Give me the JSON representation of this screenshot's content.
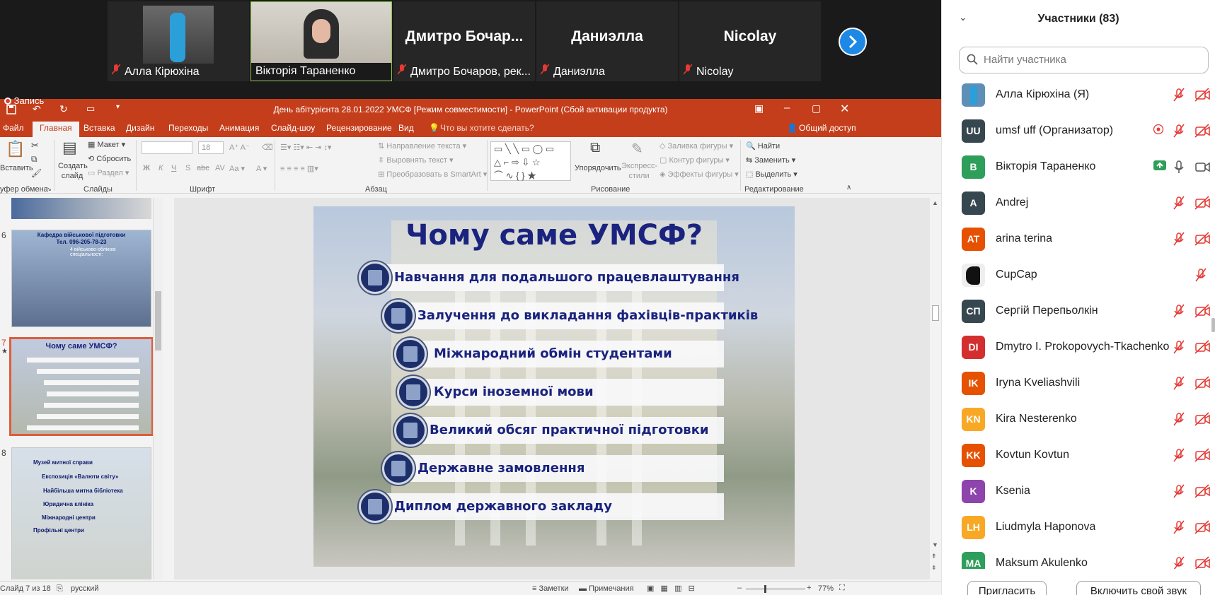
{
  "colors": {
    "ppt_accent": "#c43e1c",
    "slide_text": "#1a237e",
    "zoom_blue": "#1e88e5",
    "mute_red": "#e53935"
  },
  "videos": [
    {
      "name": "",
      "caption": "Алла Кірюхіна",
      "muted": true,
      "type": "photo"
    },
    {
      "name": "",
      "caption": "Вікторія Тараненко",
      "muted": false,
      "type": "camera"
    },
    {
      "name": "Дмитро  Бочар...",
      "caption": "Дмитро Бочаров, рек...",
      "muted": true
    },
    {
      "name": "Даниэлла",
      "caption": "Даниэлла",
      "muted": true
    },
    {
      "name": "Nicolay",
      "caption": "Nicolay",
      "muted": true
    }
  ],
  "recording_label": "Запись",
  "ppt": {
    "window_title": "День абітурієнта 28.01.2022 УМСФ [Режим совместимости] - PowerPoint (Сбой активации продукта)",
    "tabs": [
      "Файл",
      "Главная",
      "Вставка",
      "Дизайн",
      "Переходы",
      "Анимация",
      "Слайд-шоу",
      "Рецензирование",
      "Вид"
    ],
    "tell_me": "Что вы хотите сделать?",
    "share": "Общий доступ",
    "ribbon": {
      "paste": "Вставить",
      "create_slide": "Создать слайд",
      "layout": "Макет",
      "reset": "Сбросить",
      "section": "Раздел",
      "font_size": "18",
      "text_direction": "Направление текста",
      "align_text": "Выровнять текст",
      "convert_smartart": "Преобразовать в SmartArt",
      "arrange": "Упорядочить",
      "express_styles": "Экспресс-стили",
      "shape_fill": "Заливка фигуры",
      "shape_outline": "Контур фигуры",
      "shape_effects": "Эффекты фигуры",
      "find": "Найти",
      "replace": "Заменить",
      "select": "Выделить",
      "groups": {
        "clipboard": "уфер обмена",
        "slides": "Слайды",
        "font": "Шрифт",
        "paragraph": "Абзац",
        "drawing": "Рисование",
        "editing": "Редактирование"
      }
    },
    "thumbs": [
      {
        "num": "6",
        "title": "Кафедра військової підготовки",
        "phone": "Тел. 096-205-78-23",
        "sub": "4 військово-облікові спеціальності:"
      },
      {
        "num": "7",
        "title": "Чому саме УМСФ?",
        "selected": true
      },
      {
        "num": "8",
        "lines": [
          "Музей митної справи",
          "Експозиція «Валюти світу»",
          "Найбільша митна бібліотека",
          "Юридична клініка",
          "Міжнародні центри",
          "Профільні центри"
        ]
      }
    ],
    "slide": {
      "title": "Чому саме УМСФ?",
      "items": [
        "Навчання для подальшого працевлаштування",
        "Залучення до викладання фахівців-практиків",
        "Міжнародний обмін студентами",
        "Курси іноземної мови",
        "Великий обсяг практичної підготовки",
        "Державне замовлення",
        "Диплом державного закладу"
      ]
    },
    "status": {
      "slide_info": "Слайд 7 из 18",
      "language": "русский",
      "notes": "Заметки",
      "comments": "Примечания",
      "zoom": "77%"
    }
  },
  "panel": {
    "title": "Участники (83)",
    "search_placeholder": "Найти участника",
    "participants": [
      {
        "name": "Алла Кірюхіна (Я)",
        "initials": "",
        "color": "#5d8fb8",
        "icons": [
          "mic-off",
          "video-off"
        ]
      },
      {
        "name": "umsf uff (Организатор)",
        "initials": "UU",
        "color": "#37474f",
        "icons": [
          "record",
          "mic-off",
          "video-off"
        ]
      },
      {
        "name": "Вікторія Тараненко",
        "initials": "B",
        "color": "#2e9e5b",
        "icons": [
          "share",
          "mic",
          "video"
        ]
      },
      {
        "name": "Andrej",
        "initials": "A",
        "color": "#37474f",
        "icons": [
          "mic-off",
          "video-off"
        ]
      },
      {
        "name": "arina terina",
        "initials": "AT",
        "color": "#e65100",
        "icons": [
          "mic-off",
          "video-off"
        ]
      },
      {
        "name": "CupCap",
        "initials": "",
        "color": "#eeeeee",
        "icons": [
          "mic-off"
        ]
      },
      {
        "name": "Сергій Перепьолкін",
        "initials": "СП",
        "color": "#37474f",
        "icons": [
          "mic-off",
          "video-off"
        ]
      },
      {
        "name": "Dmytro I. Prokopovych-Tkachenko",
        "initials": "DI",
        "color": "#d32f2f",
        "icons": [
          "mic-off",
          "video-off"
        ]
      },
      {
        "name": "Iryna Kveliashvili",
        "initials": "IK",
        "color": "#e65100",
        "icons": [
          "mic-off",
          "video-off"
        ]
      },
      {
        "name": "Kira Nesterenko",
        "initials": "KN",
        "color": "#f9a825",
        "icons": [
          "mic-off",
          "video-off"
        ]
      },
      {
        "name": "Kovtun Kovtun",
        "initials": "KK",
        "color": "#e65100",
        "icons": [
          "mic-off",
          "video-off"
        ]
      },
      {
        "name": "Ksenia",
        "initials": "K",
        "color": "#8e44ad",
        "icons": [
          "mic-off",
          "video-off"
        ]
      },
      {
        "name": "Liudmyla Haponova",
        "initials": "LH",
        "color": "#f9a825",
        "icons": [
          "mic-off",
          "video-off"
        ]
      },
      {
        "name": "Maksum Akulenko",
        "initials": "MA",
        "color": "#2e9e5b",
        "icons": [
          "mic-off",
          "video-off"
        ]
      }
    ],
    "invite": "Пригласить",
    "unmute": "Включить свой звук"
  }
}
